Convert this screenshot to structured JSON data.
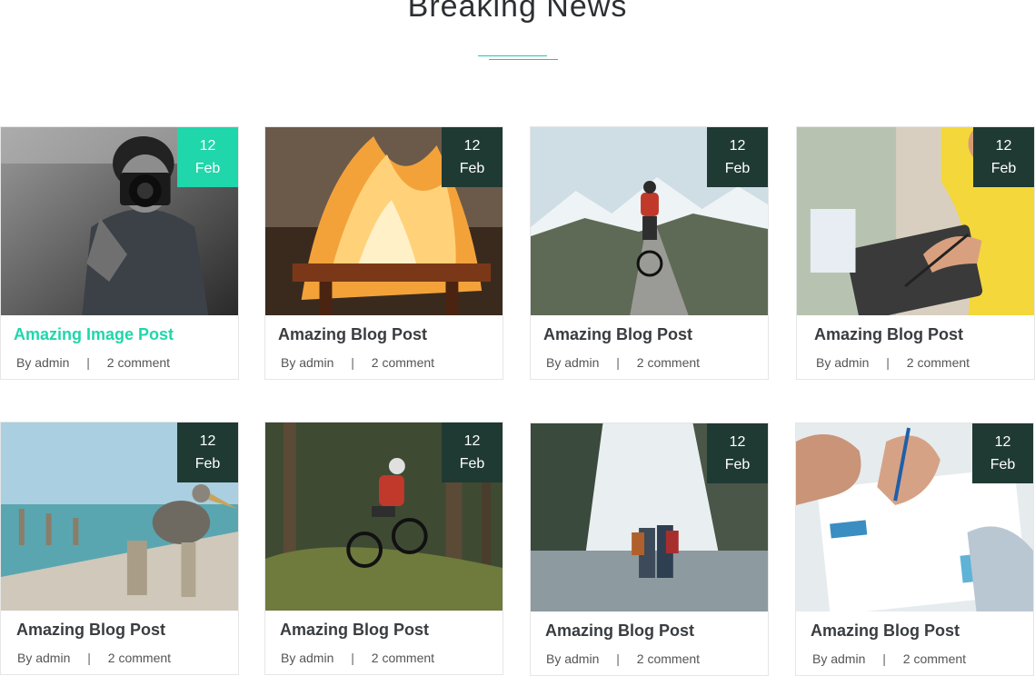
{
  "section": {
    "title": "Breaking News"
  },
  "colors": {
    "accent": "#20d6ab",
    "badge": "#1f3a33"
  },
  "posts": [
    {
      "day": "12",
      "month": "Feb",
      "title": "Amazing Image Post",
      "author_prefix": "By",
      "author": "admin",
      "separator": "|",
      "comments": "2 comment",
      "image": "photographer-with-camera"
    },
    {
      "day": "12",
      "month": "Feb",
      "title": "Amazing Blog Post",
      "author_prefix": "By",
      "author": "admin",
      "separator": "|",
      "comments": "2 comment",
      "image": "fire-over-grill"
    },
    {
      "day": "12",
      "month": "Feb",
      "title": "Amazing Blog Post",
      "author_prefix": "By",
      "author": "admin",
      "separator": "|",
      "comments": "2 comment",
      "image": "cyclist-mountain-road"
    },
    {
      "day": "12",
      "month": "Feb",
      "title": "Amazing Blog Post",
      "author_prefix": "By",
      "author": "admin",
      "separator": "|",
      "comments": "2 comment",
      "image": "man-writing-tablet"
    },
    {
      "day": "12",
      "month": "Feb",
      "title": "Amazing Blog Post",
      "author_prefix": "By",
      "author": "admin",
      "separator": "|",
      "comments": "2 comment",
      "image": "pelican-on-pier"
    },
    {
      "day": "12",
      "month": "Feb",
      "title": "Amazing Blog Post",
      "author_prefix": "By",
      "author": "admin",
      "separator": "|",
      "comments": "2 comment",
      "image": "mountain-biker-forest"
    },
    {
      "day": "12",
      "month": "Feb",
      "title": "Amazing Blog Post",
      "author_prefix": "By",
      "author": "admin",
      "separator": "|",
      "comments": "2 comment",
      "image": "hikers-waterfall"
    },
    {
      "day": "12",
      "month": "Feb",
      "title": "Amazing Blog Post",
      "author_prefix": "By",
      "author": "admin",
      "separator": "|",
      "comments": "2 comment",
      "image": "hand-writing-document"
    }
  ]
}
